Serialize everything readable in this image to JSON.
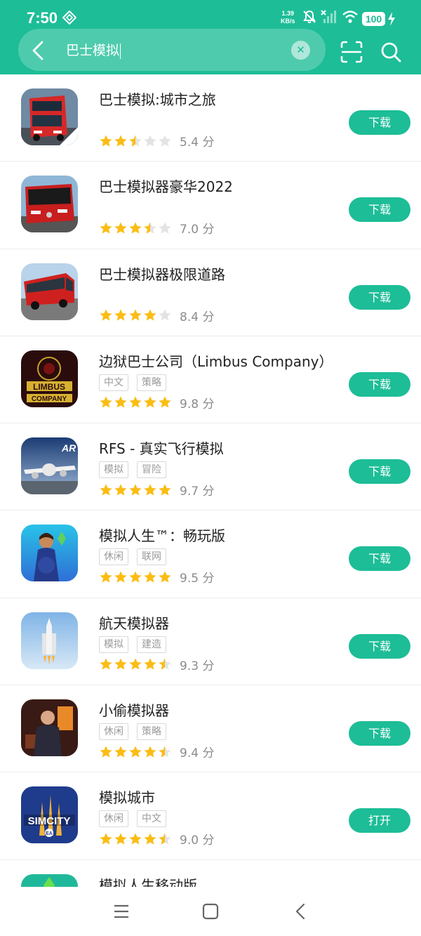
{
  "status_bar": {
    "time": "7:50",
    "net_speed_value": "1.39",
    "net_speed_unit": "KB/s",
    "battery": "100"
  },
  "search": {
    "query": "巴士模拟"
  },
  "colors": {
    "accent": "#1dbd97",
    "star": "#fbbd14",
    "star_empty": "#e3e3e3"
  },
  "apps": [
    {
      "name": "巴士模拟:城市之旅",
      "tags": [],
      "rating": 2.5,
      "score": "5.4 分",
      "button": "下载",
      "icon": "bus-city-icon"
    },
    {
      "name": "巴士模拟器豪华2022",
      "tags": [],
      "rating": 3.5,
      "score": "7.0 分",
      "button": "下载",
      "icon": "bus-luxury-icon"
    },
    {
      "name": "巴士模拟器极限道路",
      "tags": [],
      "rating": 4,
      "score": "8.4 分",
      "button": "下载",
      "icon": "bus-road-icon"
    },
    {
      "name": "边狱巴士公司（Limbus Company）",
      "tags": [
        "中文",
        "策略"
      ],
      "rating": 5,
      "score": "9.8 分",
      "button": "下载",
      "icon": "limbus-icon"
    },
    {
      "name": "RFS - 真实飞行模拟",
      "tags": [
        "模拟",
        "冒险"
      ],
      "rating": 5,
      "score": "9.7 分",
      "button": "下载",
      "icon": "airplane-icon"
    },
    {
      "name": "模拟人生™：畅玩版",
      "tags": [
        "休闲",
        "联网"
      ],
      "rating": 5,
      "score": "9.5 分",
      "button": "下载",
      "icon": "sims-icon"
    },
    {
      "name": "航天模拟器",
      "tags": [
        "模拟",
        "建造"
      ],
      "rating": 4.5,
      "score": "9.3 分",
      "button": "下载",
      "icon": "rocket-icon"
    },
    {
      "name": "小偷模拟器",
      "tags": [
        "休闲",
        "策略"
      ],
      "rating": 4.5,
      "score": "9.4 分",
      "button": "下载",
      "icon": "thief-icon"
    },
    {
      "name": "模拟城市",
      "tags": [
        "休闲",
        "中文"
      ],
      "rating": 4.5,
      "score": "9.0 分",
      "button": "打开",
      "icon": "simcity-icon"
    },
    {
      "name": "模拟人生移动版",
      "tags": [],
      "rating": 0,
      "score": "",
      "button": "",
      "icon": "sims-mobile-icon"
    }
  ]
}
